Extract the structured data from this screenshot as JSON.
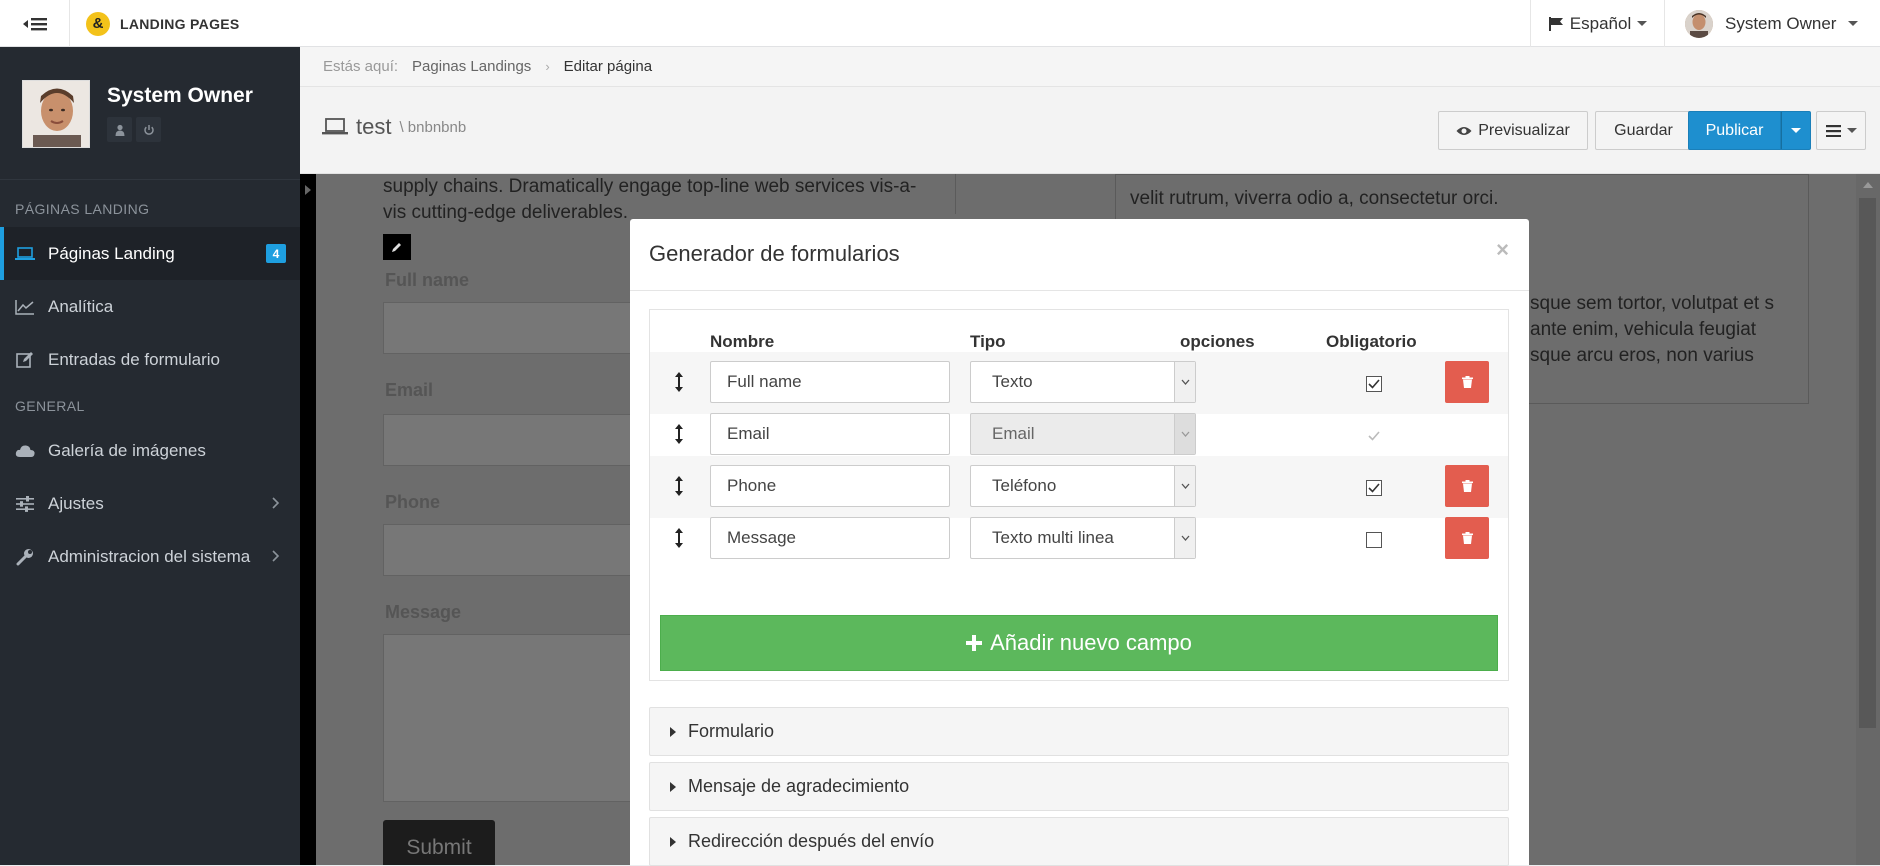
{
  "topbar": {
    "brand": "LANDING PAGES",
    "brand_mark": "&",
    "language": "Español",
    "user": "System Owner"
  },
  "sidebar": {
    "user_name": "System Owner",
    "section_landing": "PÁGINAS LANDING",
    "section_general": "GENERAL",
    "items": [
      {
        "label": "Páginas Landing",
        "icon": "laptop-icon",
        "badge": "4"
      },
      {
        "label": "Analítica",
        "icon": "line-chart-icon"
      },
      {
        "label": "Entradas de formulario",
        "icon": "edit-icon"
      },
      {
        "label": "Galería de imágenes",
        "icon": "cloud-icon"
      },
      {
        "label": "Ajustes",
        "icon": "sliders-icon"
      },
      {
        "label": "Administracion del sistema",
        "icon": "wrench-icon"
      }
    ]
  },
  "breadcrumb": {
    "prefix": "Estás aquí:",
    "crumbs": [
      "Paginas Landings",
      "Editar página"
    ]
  },
  "page": {
    "title": "test",
    "subtitle": "\\ bnbnbnb",
    "preview": "Previsualizar",
    "save": "Guardar",
    "publish": "Publicar"
  },
  "background": {
    "text_left": "supply chains. Dramatically engage top-line web services vis-a-vis cutting-edge deliverables.",
    "text_right_top": "velit rutrum, viverra odio a, consectetur orci.",
    "text_right_mid": "sque sem tortor, volutpat et s ante enim, vehicula feugiat sque arcu eros, non varius",
    "labels": [
      "Full name",
      "Email",
      "Phone",
      "Message"
    ],
    "submit": "Submit"
  },
  "modal": {
    "title": "Generador de formularios",
    "close": "×",
    "headers": {
      "name": "Nombre",
      "type": "Tipo",
      "options": "opciones",
      "required": "Obligatorio"
    },
    "rows": [
      {
        "name": "Full name",
        "type": "Texto",
        "required": true,
        "disabled": false,
        "deletable": true
      },
      {
        "name": "Email",
        "type": "Email",
        "required": true,
        "disabled": true,
        "deletable": false
      },
      {
        "name": "Phone",
        "type": "Teléfono",
        "required": true,
        "disabled": false,
        "deletable": true
      },
      {
        "name": "Message",
        "type": "Texto multi linea",
        "required": false,
        "disabled": false,
        "deletable": true
      }
    ],
    "add_field": "Añadir nuevo campo",
    "sections": [
      "Formulario",
      "Mensaje de agradecimiento",
      "Redirección después del envío"
    ]
  },
  "colors": {
    "sidebar_bg": "#252a31",
    "accent": "#1e9fe0",
    "publish": "#1e8fcf",
    "add": "#5cb85c",
    "delete": "#e35d4f"
  }
}
